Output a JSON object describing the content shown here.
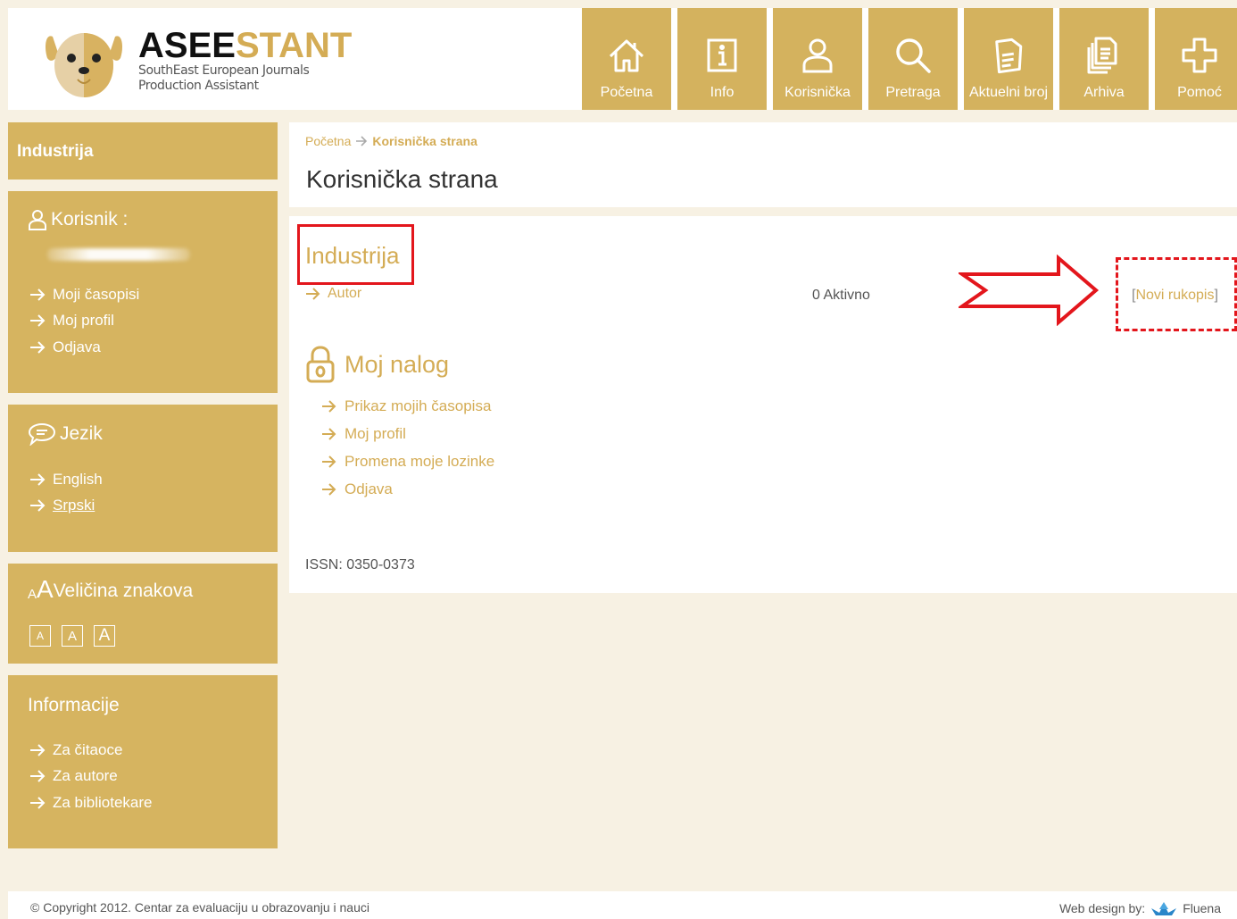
{
  "brand": {
    "name_dark": "ASEE",
    "name_gold": "STANT",
    "sub_line1": "SouthEast European Journals",
    "sub_line2": "Production Assistant"
  },
  "nav": [
    {
      "label": "Početna",
      "icon": "home-icon"
    },
    {
      "label": "Info",
      "icon": "info-icon"
    },
    {
      "label": "Korisnička",
      "icon": "user-icon"
    },
    {
      "label": "Pretraga",
      "icon": "search-icon"
    },
    {
      "label": "Aktuelni broj",
      "icon": "current-issue-icon"
    },
    {
      "label": "Arhiva",
      "icon": "archive-icon"
    },
    {
      "label": "Pomoć",
      "icon": "help-icon"
    }
  ],
  "sidebar": {
    "journal": "Industrija",
    "user": {
      "heading": "Korisnik :",
      "links": [
        "Moji časopisi",
        "Moj profil",
        "Odjava"
      ]
    },
    "language": {
      "heading": "Jezik",
      "links": [
        "English",
        "Srpski"
      ]
    },
    "font_size": {
      "heading_small": "A",
      "heading_big": "A",
      "heading_text": "Veličina znakova",
      "buttons": [
        "A",
        "A",
        "A"
      ]
    },
    "info": {
      "heading": "Informacije",
      "links": [
        "Za čitaoce",
        "Za autore",
        "Za bibliotekare"
      ]
    }
  },
  "breadcrumb": {
    "home": "Početna",
    "current": "Korisnička strana"
  },
  "page_title": "Korisnička strana",
  "content": {
    "journal_title": "Industrija",
    "role": "Autor",
    "active_count": "0 Aktivno",
    "new_submission_open": "[",
    "new_submission": "Novi rukopis",
    "new_submission_close": "]",
    "account_heading": "Moj nalog",
    "account_links": [
      "Prikaz mojih časopisa",
      "Moj profil",
      "Promena moje lozinke",
      "Odjava"
    ],
    "issn": "ISSN: 0350-0373"
  },
  "footer": {
    "copyright": "© Copyright 2012. Centar za evaluaciju u obrazovanju i nauci",
    "design_label": "Web design by:",
    "design_company": "Fluena"
  },
  "colors": {
    "gold": "#d4b25e",
    "gold_text": "#d4ac55",
    "highlight_red": "#e3161c",
    "page_bg": "#f7f1e3"
  }
}
